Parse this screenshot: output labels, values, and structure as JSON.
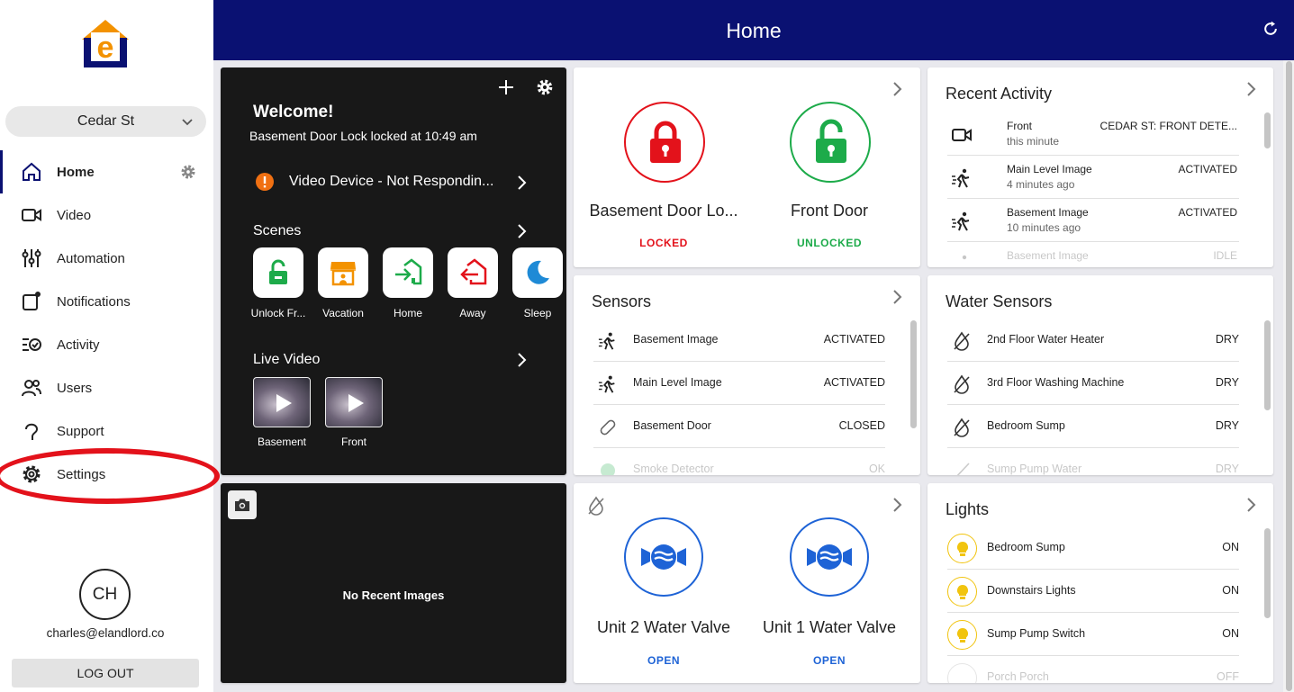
{
  "header": {
    "title": "Home"
  },
  "sidebar": {
    "property": "Cedar St",
    "nav": [
      {
        "label": "Home"
      },
      {
        "label": "Video"
      },
      {
        "label": "Automation"
      },
      {
        "label": "Notifications"
      },
      {
        "label": "Activity"
      },
      {
        "label": "Users"
      },
      {
        "label": "Support"
      },
      {
        "label": "Settings"
      }
    ],
    "user": {
      "initials": "CH",
      "email": "charles@elandlord.co"
    },
    "logout": "LOG OUT"
  },
  "welcome": {
    "title": "Welcome!",
    "subtitle": "Basement Door Lock locked at 10:49 am",
    "alert": "Video Device - Not Respondin...",
    "scenes_title": "Scenes",
    "scenes": [
      {
        "label": "Unlock Fr...",
        "icon": "unlock-icon"
      },
      {
        "label": "Vacation",
        "icon": "store-icon"
      },
      {
        "label": "Home",
        "icon": "home-arrive-icon"
      },
      {
        "label": "Away",
        "icon": "home-leave-icon"
      },
      {
        "label": "Sleep",
        "icon": "moon-icon"
      }
    ],
    "live_video_title": "Live Video",
    "videos": [
      {
        "label": "Basement"
      },
      {
        "label": "Front"
      }
    ]
  },
  "recent_images": {
    "empty_text": "No Recent Images"
  },
  "locks": [
    {
      "name": "Basement Door Lo...",
      "state": "LOCKED"
    },
    {
      "name": "Front Door",
      "state": "UNLOCKED"
    }
  ],
  "recent_activity": {
    "title": "Recent Activity",
    "items": [
      {
        "name": "Front",
        "time": "this minute",
        "status": "CEDAR ST: FRONT DETE...",
        "icon": "video-camera-icon"
      },
      {
        "name": "Main Level Image",
        "time": "4 minutes ago",
        "status": "ACTIVATED",
        "icon": "motion-icon"
      },
      {
        "name": "Basement Image",
        "time": "10 minutes ago",
        "status": "ACTIVATED",
        "icon": "motion-icon"
      },
      {
        "name": "Basement Image",
        "time": "",
        "status": "IDLE",
        "icon": "motion-icon"
      }
    ]
  },
  "sensors": {
    "title": "Sensors",
    "items": [
      {
        "name": "Basement Image",
        "status": "ACTIVATED",
        "icon": "motion-icon"
      },
      {
        "name": "Main Level Image",
        "status": "ACTIVATED",
        "icon": "motion-icon"
      },
      {
        "name": "Basement Door",
        "status": "CLOSED",
        "icon": "door-sensor-icon"
      },
      {
        "name": "Smoke Detector",
        "status": "OK",
        "icon": "smoke-icon"
      }
    ]
  },
  "water_sensors": {
    "title": "Water Sensors",
    "items": [
      {
        "name": "2nd Floor Water Heater",
        "status": "DRY"
      },
      {
        "name": "3rd Floor Washing Machine",
        "status": "DRY"
      },
      {
        "name": "Bedroom Sump",
        "status": "DRY"
      },
      {
        "name": "Sump Pump Water",
        "status": "DRY"
      }
    ]
  },
  "valves": [
    {
      "name": "Unit 2 Water Valve",
      "state": "OPEN"
    },
    {
      "name": "Unit 1 Water Valve",
      "state": "OPEN"
    }
  ],
  "lights": {
    "title": "Lights",
    "items": [
      {
        "name": "Bedroom Sump",
        "status": "ON"
      },
      {
        "name": "Downstairs Lights",
        "status": "ON"
      },
      {
        "name": "Sump Pump Switch",
        "status": "ON"
      },
      {
        "name": "Porch Porch",
        "status": "OFF"
      }
    ]
  },
  "colors": {
    "brand_navy": "#0a1172",
    "locked_red": "#e3121b",
    "unlocked_green": "#1dab4a",
    "valve_blue": "#1e63d6",
    "light_yellow": "#f1c40f",
    "alert_orange": "#f07012"
  }
}
